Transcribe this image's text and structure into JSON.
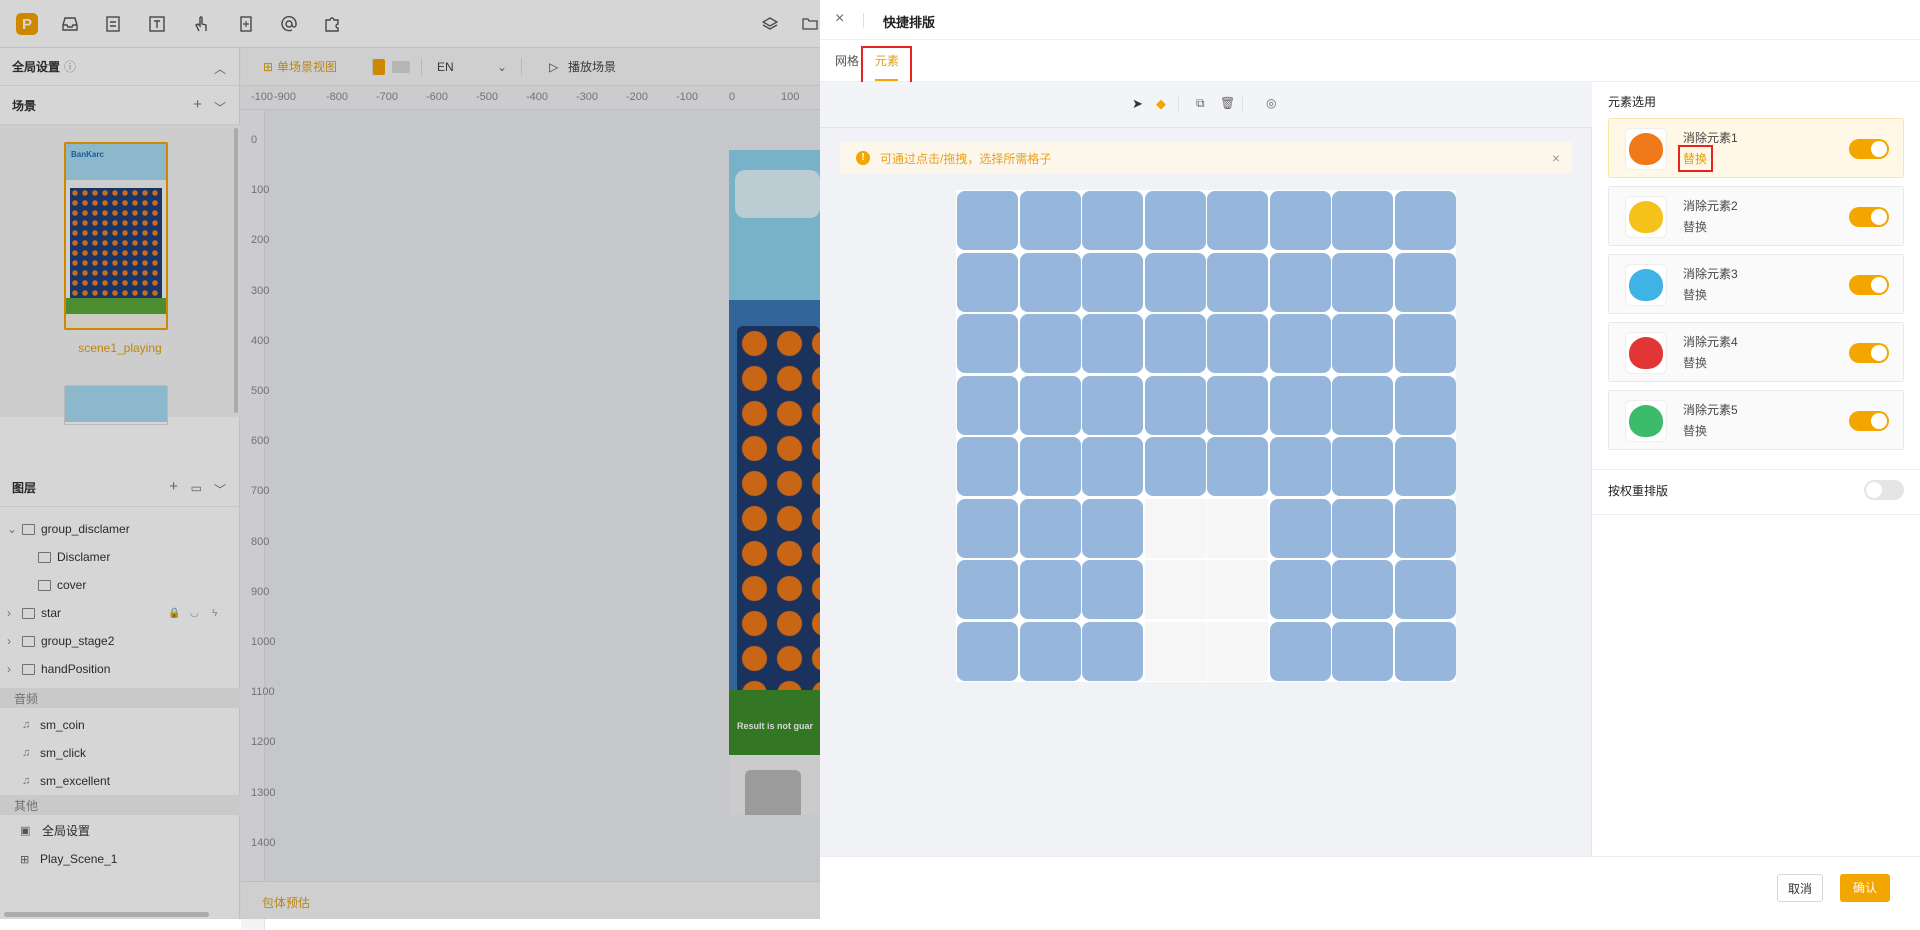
{
  "editor": {
    "topbar_icons": [
      "logo-icon",
      "inbox-icon",
      "list-icon",
      "text-icon",
      "gesture-icon",
      "document-icon",
      "at-icon",
      "puzzle-icon"
    ],
    "global_settings_label": "全局设置",
    "scenes_label": "场景",
    "scene_name": "scene1_playing",
    "layers_label": "图层",
    "layers": [
      {
        "name": "group_disclamer",
        "type": "folder",
        "expanded": true
      },
      {
        "name": "Disclamer",
        "type": "text",
        "child": true
      },
      {
        "name": "cover",
        "type": "image",
        "child": true
      },
      {
        "name": "star",
        "type": "folder"
      },
      {
        "name": "group_stage2",
        "type": "folder"
      },
      {
        "name": "handPosition",
        "type": "folder"
      }
    ],
    "audio_label": "音频",
    "audio": [
      "sm_coin",
      "sm_click",
      "sm_excellent"
    ],
    "other_label": "其他",
    "other": [
      "全局设置",
      "Play_Scene_1"
    ],
    "view_toolbar": {
      "single_scene_view": "单场景视图",
      "language": "EN",
      "play_scene": "播放场景"
    },
    "ruler_x": [
      "-100",
      "-900",
      "-800",
      "-700",
      "-600",
      "-500",
      "-400",
      "-300",
      "-200",
      "-100",
      "0",
      "100"
    ],
    "ruler_y": [
      "0",
      "100",
      "200",
      "300",
      "400",
      "500",
      "600",
      "700",
      "800",
      "900",
      "1000",
      "1100",
      "1200",
      "1300",
      "1400"
    ],
    "bottom_label": "包体预估",
    "preview_text": "Result is not guar",
    "thumb_brand": "BanKarc"
  },
  "drawer": {
    "title": "快捷排版",
    "tabs": [
      "网格",
      "元素"
    ],
    "active_tab": "元素",
    "alert": "可通过点击/拖拽，选择所需格子",
    "grid": {
      "rows": 8,
      "cols": 8,
      "inactive_cells": [
        [
          5,
          3
        ],
        [
          5,
          4
        ],
        [
          6,
          3
        ],
        [
          6,
          4
        ],
        [
          7,
          3
        ],
        [
          7,
          4
        ]
      ]
    },
    "elements_title": "元素选用",
    "replace_label": "替换",
    "elements": [
      {
        "name": "消除元素1",
        "color": "#f07a1a",
        "enabled": true,
        "selected": true
      },
      {
        "name": "消除元素2",
        "color": "#f5c21b",
        "enabled": true
      },
      {
        "name": "消除元素3",
        "color": "#3fb2e6",
        "enabled": true
      },
      {
        "name": "消除元素4",
        "color": "#e23535",
        "enabled": true
      },
      {
        "name": "消除元素5",
        "color": "#3cbb6a",
        "enabled": true
      }
    ],
    "weight_relayout": {
      "label": "按权重排版",
      "enabled": false
    },
    "cancel": "取消",
    "confirm": "确认"
  },
  "colors": {
    "accent": "#f3a500",
    "cell": "#97b6db",
    "highlight": "#e8231f"
  }
}
